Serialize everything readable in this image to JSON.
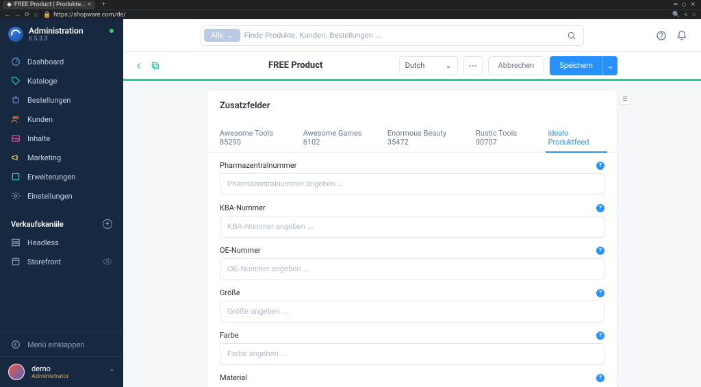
{
  "browser": {
    "tab_title": "FREE Product | Produkte…",
    "url": "https://shopware.com/de/"
  },
  "header": {
    "title": "Administration",
    "version": "6.5.3.3"
  },
  "nav": [
    {
      "key": "dashboard",
      "label": "Dashboard"
    },
    {
      "key": "catalogues",
      "label": "Kataloge"
    },
    {
      "key": "orders",
      "label": "Bestellungen"
    },
    {
      "key": "customers",
      "label": "Kunden"
    },
    {
      "key": "content",
      "label": "Inhalte"
    },
    {
      "key": "marketing",
      "label": "Marketing"
    },
    {
      "key": "extensions",
      "label": "Erweiterungen"
    },
    {
      "key": "settings",
      "label": "Einstellungen"
    }
  ],
  "sales_channels": {
    "header": "Verkaufskanäle",
    "items": [
      {
        "key": "headless",
        "label": "Headless"
      },
      {
        "key": "storefront",
        "label": "Storefront",
        "has_eye": true
      }
    ]
  },
  "collapse_label": "Menü einklappen",
  "user": {
    "name": "demo",
    "role": "Administrator"
  },
  "search": {
    "scope_label": "Alle",
    "placeholder": "Finde Produkte, Kunden, Bestellungen ..."
  },
  "page": {
    "title": "FREE Product",
    "language": "Dutch",
    "cancel": "Abbrechen",
    "save": "Speichern"
  },
  "card": {
    "title": "Zusatzfelder",
    "tabs": [
      {
        "key": "t1",
        "label": "Awesome Tools 85290"
      },
      {
        "key": "t2",
        "label": "Awesome Games 6102"
      },
      {
        "key": "t3",
        "label": "Enormous Beauty 35472"
      },
      {
        "key": "t4",
        "label": "Rustic Tools 90707"
      },
      {
        "key": "t5",
        "label": "idealo Produktfeed",
        "active": true
      }
    ],
    "fields": [
      {
        "key": "pzn",
        "label": "Pharmazentralnummer",
        "placeholder": "Pharmazentralnummer angeben ..."
      },
      {
        "key": "kba",
        "label": "KBA-Nummer",
        "placeholder": "KBA-Nummer angeben ..."
      },
      {
        "key": "oe",
        "label": "OE-Nummer",
        "placeholder": "OE-Nummer angeben ..."
      },
      {
        "key": "size",
        "label": "Größe",
        "placeholder": "Größe angeben ..."
      },
      {
        "key": "color",
        "label": "Farbe",
        "placeholder": "Farbe angeben ..."
      },
      {
        "key": "mat",
        "label": "Material",
        "placeholder": ""
      }
    ]
  }
}
